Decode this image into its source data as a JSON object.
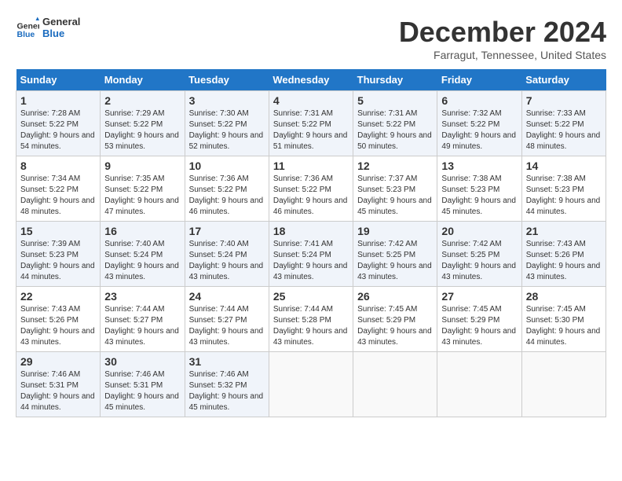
{
  "logo": {
    "text_general": "General",
    "text_blue": "Blue"
  },
  "header": {
    "month": "December 2024",
    "location": "Farragut, Tennessee, United States"
  },
  "days_of_week": [
    "Sunday",
    "Monday",
    "Tuesday",
    "Wednesday",
    "Thursday",
    "Friday",
    "Saturday"
  ],
  "weeks": [
    [
      {
        "day": "1",
        "sunrise": "7:28 AM",
        "sunset": "5:22 PM",
        "daylight": "9 hours and 54 minutes."
      },
      {
        "day": "2",
        "sunrise": "7:29 AM",
        "sunset": "5:22 PM",
        "daylight": "9 hours and 53 minutes."
      },
      {
        "day": "3",
        "sunrise": "7:30 AM",
        "sunset": "5:22 PM",
        "daylight": "9 hours and 52 minutes."
      },
      {
        "day": "4",
        "sunrise": "7:31 AM",
        "sunset": "5:22 PM",
        "daylight": "9 hours and 51 minutes."
      },
      {
        "day": "5",
        "sunrise": "7:31 AM",
        "sunset": "5:22 PM",
        "daylight": "9 hours and 50 minutes."
      },
      {
        "day": "6",
        "sunrise": "7:32 AM",
        "sunset": "5:22 PM",
        "daylight": "9 hours and 49 minutes."
      },
      {
        "day": "7",
        "sunrise": "7:33 AM",
        "sunset": "5:22 PM",
        "daylight": "9 hours and 48 minutes."
      }
    ],
    [
      {
        "day": "8",
        "sunrise": "7:34 AM",
        "sunset": "5:22 PM",
        "daylight": "9 hours and 48 minutes."
      },
      {
        "day": "9",
        "sunrise": "7:35 AM",
        "sunset": "5:22 PM",
        "daylight": "9 hours and 47 minutes."
      },
      {
        "day": "10",
        "sunrise": "7:36 AM",
        "sunset": "5:22 PM",
        "daylight": "9 hours and 46 minutes."
      },
      {
        "day": "11",
        "sunrise": "7:36 AM",
        "sunset": "5:22 PM",
        "daylight": "9 hours and 46 minutes."
      },
      {
        "day": "12",
        "sunrise": "7:37 AM",
        "sunset": "5:23 PM",
        "daylight": "9 hours and 45 minutes."
      },
      {
        "day": "13",
        "sunrise": "7:38 AM",
        "sunset": "5:23 PM",
        "daylight": "9 hours and 45 minutes."
      },
      {
        "day": "14",
        "sunrise": "7:38 AM",
        "sunset": "5:23 PM",
        "daylight": "9 hours and 44 minutes."
      }
    ],
    [
      {
        "day": "15",
        "sunrise": "7:39 AM",
        "sunset": "5:23 PM",
        "daylight": "9 hours and 44 minutes."
      },
      {
        "day": "16",
        "sunrise": "7:40 AM",
        "sunset": "5:24 PM",
        "daylight": "9 hours and 43 minutes."
      },
      {
        "day": "17",
        "sunrise": "7:40 AM",
        "sunset": "5:24 PM",
        "daylight": "9 hours and 43 minutes."
      },
      {
        "day": "18",
        "sunrise": "7:41 AM",
        "sunset": "5:24 PM",
        "daylight": "9 hours and 43 minutes."
      },
      {
        "day": "19",
        "sunrise": "7:42 AM",
        "sunset": "5:25 PM",
        "daylight": "9 hours and 43 minutes."
      },
      {
        "day": "20",
        "sunrise": "7:42 AM",
        "sunset": "5:25 PM",
        "daylight": "9 hours and 43 minutes."
      },
      {
        "day": "21",
        "sunrise": "7:43 AM",
        "sunset": "5:26 PM",
        "daylight": "9 hours and 43 minutes."
      }
    ],
    [
      {
        "day": "22",
        "sunrise": "7:43 AM",
        "sunset": "5:26 PM",
        "daylight": "9 hours and 43 minutes."
      },
      {
        "day": "23",
        "sunrise": "7:44 AM",
        "sunset": "5:27 PM",
        "daylight": "9 hours and 43 minutes."
      },
      {
        "day": "24",
        "sunrise": "7:44 AM",
        "sunset": "5:27 PM",
        "daylight": "9 hours and 43 minutes."
      },
      {
        "day": "25",
        "sunrise": "7:44 AM",
        "sunset": "5:28 PM",
        "daylight": "9 hours and 43 minutes."
      },
      {
        "day": "26",
        "sunrise": "7:45 AM",
        "sunset": "5:29 PM",
        "daylight": "9 hours and 43 minutes."
      },
      {
        "day": "27",
        "sunrise": "7:45 AM",
        "sunset": "5:29 PM",
        "daylight": "9 hours and 43 minutes."
      },
      {
        "day": "28",
        "sunrise": "7:45 AM",
        "sunset": "5:30 PM",
        "daylight": "9 hours and 44 minutes."
      }
    ],
    [
      {
        "day": "29",
        "sunrise": "7:46 AM",
        "sunset": "5:31 PM",
        "daylight": "9 hours and 44 minutes."
      },
      {
        "day": "30",
        "sunrise": "7:46 AM",
        "sunset": "5:31 PM",
        "daylight": "9 hours and 45 minutes."
      },
      {
        "day": "31",
        "sunrise": "7:46 AM",
        "sunset": "5:32 PM",
        "daylight": "9 hours and 45 minutes."
      },
      null,
      null,
      null,
      null
    ]
  ],
  "labels": {
    "sunrise": "Sunrise:",
    "sunset": "Sunset:",
    "daylight": "Daylight:"
  }
}
